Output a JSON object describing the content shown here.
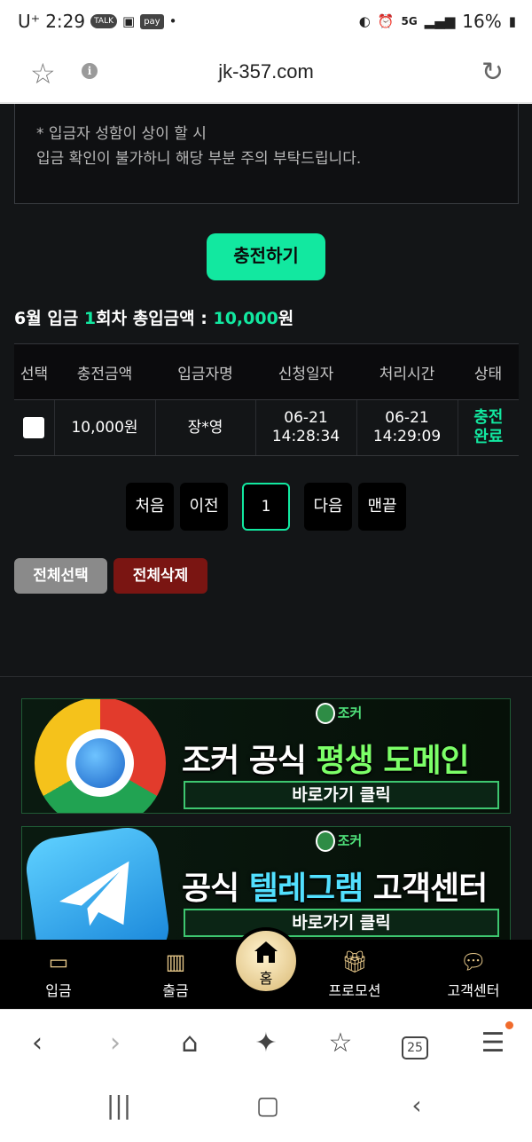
{
  "status_bar": {
    "carrier": "U⁺",
    "time": "2:29",
    "app_chips": [
      "TALK",
      "pay"
    ],
    "network": "5G",
    "battery": "16%"
  },
  "address_bar": {
    "url": "jk-357.com"
  },
  "notice": {
    "line1": "* 입금자 성함이 상이 할 시",
    "line2": "입금 확인이 불가하니 해당 부분 주의 부탁드립니다."
  },
  "charge_button": "충전하기",
  "summary": {
    "month": "6월 입금",
    "count": "1",
    "count_suffix": "회차 총입금액 : ",
    "total": "10,000",
    "unit": "원"
  },
  "table": {
    "headers": [
      "선택",
      "충전금액",
      "입금자명",
      "신청일자",
      "처리시간",
      "상태"
    ],
    "rows": [
      {
        "amount": "10,000원",
        "depositor": "장*영",
        "request_date": "06-21",
        "request_time": "14:28:34",
        "process_date": "06-21",
        "process_time": "14:29:09",
        "status_line1": "충전",
        "status_line2": "완료"
      }
    ]
  },
  "pagination": {
    "first": "처음",
    "prev": "이전",
    "current": "1",
    "next": "다음",
    "last": "맨끝"
  },
  "actions": {
    "select_all": "전체선택",
    "delete_all": "전체삭제"
  },
  "banners": [
    {
      "brand": "조커",
      "title_white": "조커 공식 ",
      "title_highlight": "평생 도메인",
      "subtitle": "바로가기 클릭",
      "highlight_color": "#7cff68"
    },
    {
      "brand": "조커",
      "title_white": "공식 ",
      "title_highlight": "텔레그램",
      "title_white2": " 고객센터",
      "subtitle": "바로가기 클릭",
      "highlight_color": "#52e0ff"
    }
  ],
  "site_nav": {
    "deposit": "입금",
    "withdraw": "출금",
    "home": "홈",
    "promotion": "프로모션",
    "support": "고객센터"
  },
  "browser_toolbar": {
    "tab_count": "25"
  },
  "colors": {
    "accent": "#12e8a0",
    "background": "#131517",
    "delete": "#7a1512",
    "select": "#8a8a8a"
  }
}
